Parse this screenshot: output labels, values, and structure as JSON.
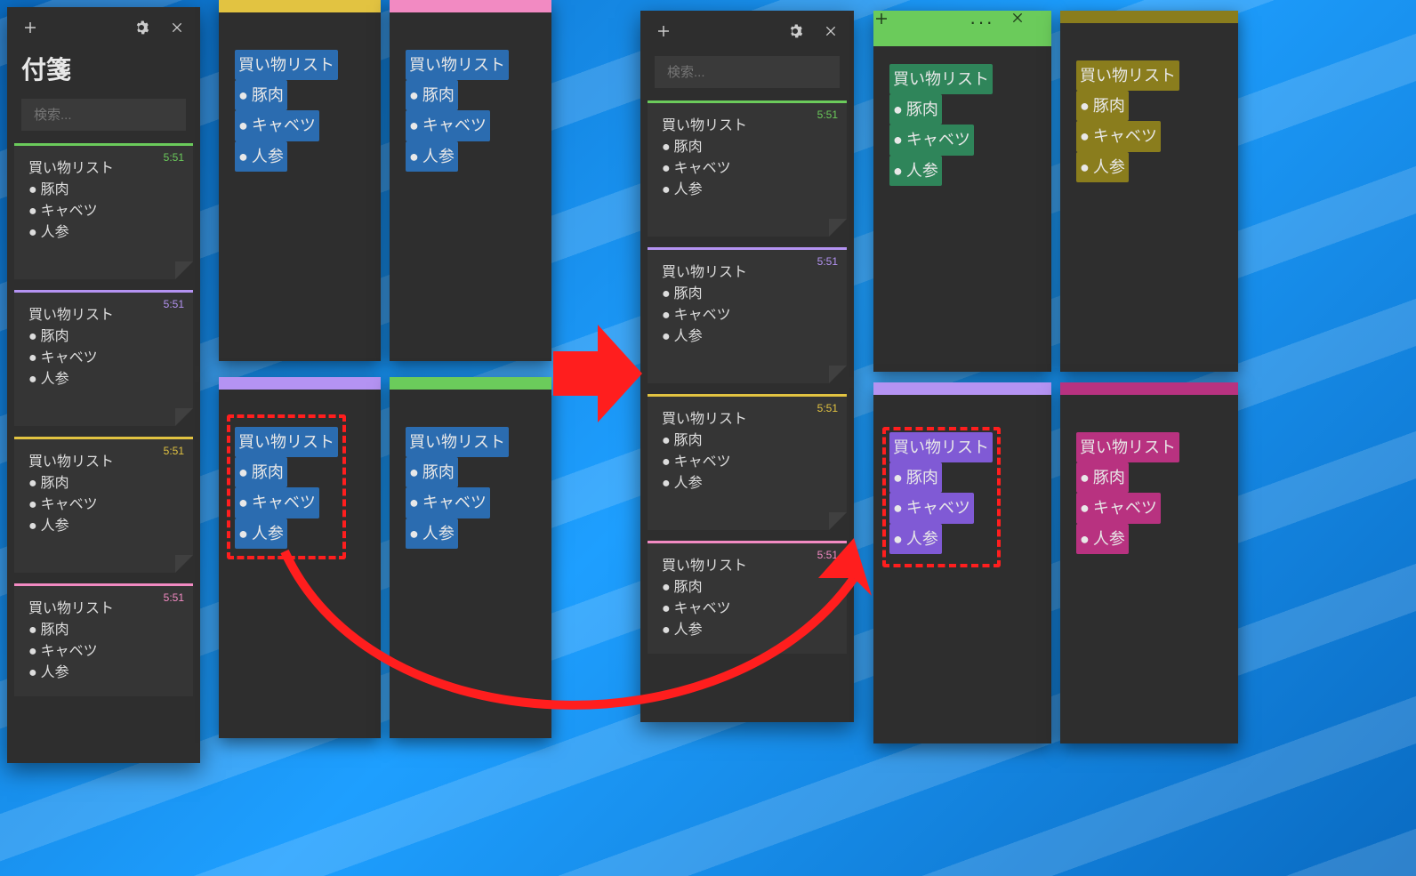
{
  "app": {
    "title": "付箋"
  },
  "search": {
    "placeholder": "検索..."
  },
  "note": {
    "title": "買い物リスト",
    "items": [
      "豚肉",
      "キャベツ",
      "人参"
    ],
    "time": "5:51"
  },
  "colors": {
    "green": "#6BCB5B",
    "purple": "#B493F2",
    "yellow": "#E2C341",
    "pink": "#F28AC2",
    "blue": "#2B6CB0",
    "olive": "#8A7D1D",
    "magenta": "#B83280",
    "hpurple": "#805AD5"
  }
}
